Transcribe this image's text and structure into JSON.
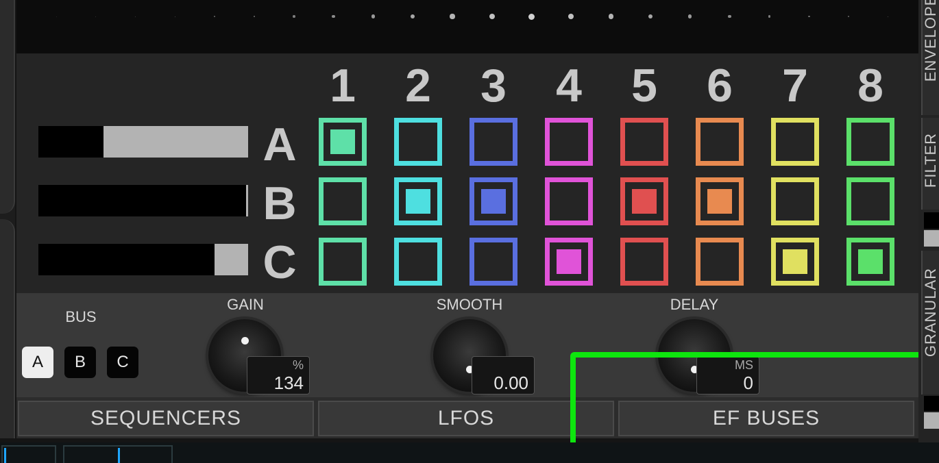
{
  "columns": [
    "1",
    "2",
    "3",
    "4",
    "5",
    "6",
    "7",
    "8"
  ],
  "rows": [
    {
      "letter": "A",
      "level": 0.69,
      "active": [
        1
      ]
    },
    {
      "letter": "B",
      "level": 0.01,
      "active": [
        2,
        3,
        5,
        6
      ]
    },
    {
      "letter": "C",
      "level": 0.16,
      "active": [
        4,
        7,
        8
      ]
    }
  ],
  "column_colors": [
    "#5ee0a8",
    "#4edfe0",
    "#5a6fe0",
    "#e053d8",
    "#e05050",
    "#e88a50",
    "#e0e060",
    "#5be06a"
  ],
  "bus": {
    "label": "BUS",
    "buttons": [
      "A",
      "B",
      "C"
    ],
    "selected": "A"
  },
  "knobs": [
    {
      "label": "GAIN",
      "unit": "%",
      "value": "134"
    },
    {
      "label": "SMOOTH",
      "unit": "",
      "value": "0.00"
    },
    {
      "label": "DELAY",
      "unit": "MS",
      "value": "0"
    }
  ],
  "tabs": [
    "SEQUENCERS",
    "LFOS",
    "",
    "EF BUSES"
  ],
  "side_tabs": [
    "ENVELOPE",
    "FILTER",
    "GRANULAR"
  ]
}
